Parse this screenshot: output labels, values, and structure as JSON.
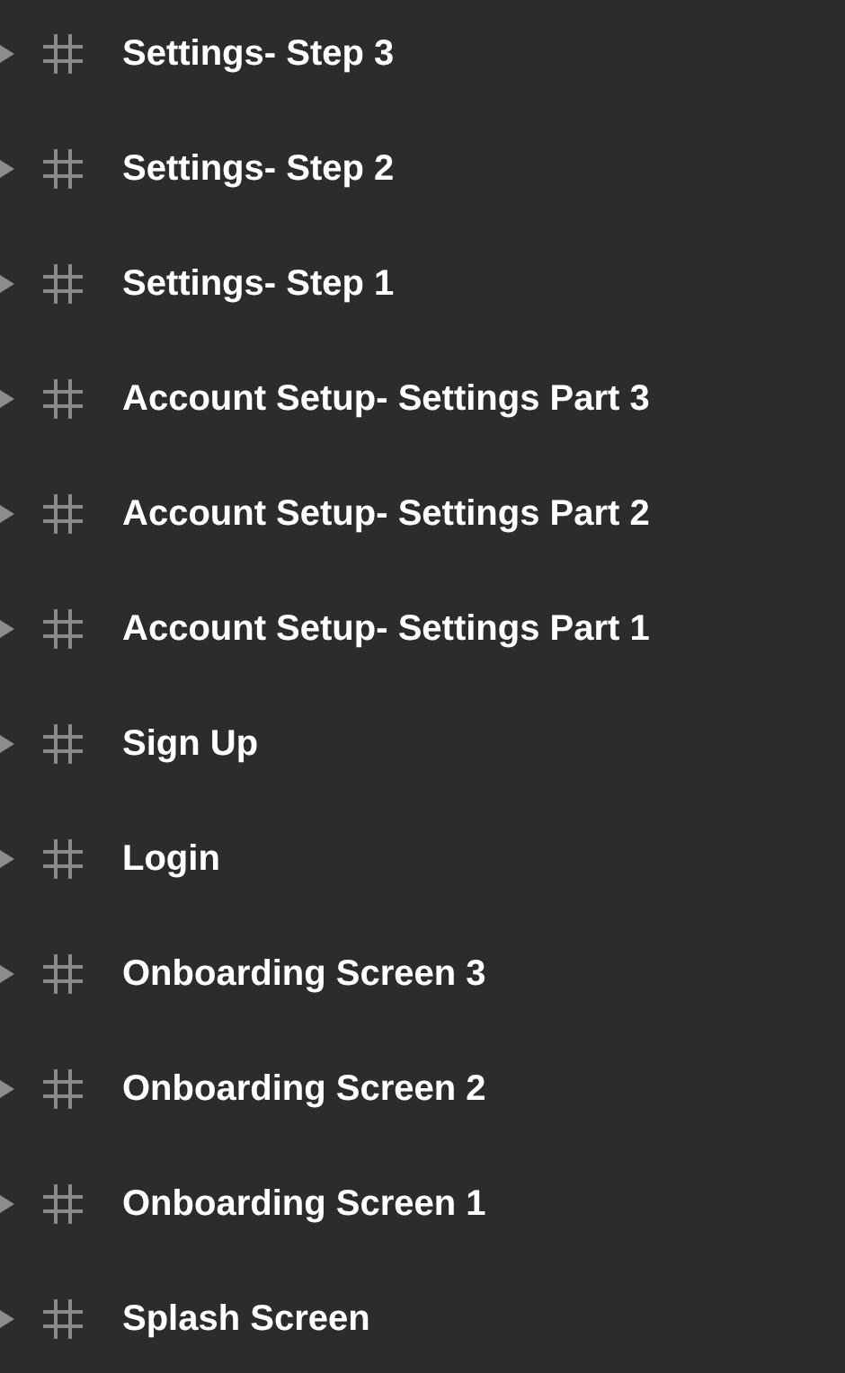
{
  "layers": [
    {
      "name": "Settings- Step 3",
      "expanded": false
    },
    {
      "name": "Settings- Step 2",
      "expanded": false
    },
    {
      "name": "Settings- Step 1",
      "expanded": false
    },
    {
      "name": "Account Setup- Settings Part 3",
      "expanded": false
    },
    {
      "name": "Account Setup- Settings Part 2",
      "expanded": false
    },
    {
      "name": "Account Setup- Settings Part 1",
      "expanded": false
    },
    {
      "name": "Sign Up",
      "expanded": false
    },
    {
      "name": "Login",
      "expanded": false
    },
    {
      "name": "Onboarding Screen 3",
      "expanded": false
    },
    {
      "name": "Onboarding Screen 2",
      "expanded": false
    },
    {
      "name": "Onboarding Screen 1",
      "expanded": false
    },
    {
      "name": "Splash Screen",
      "expanded": false
    }
  ]
}
